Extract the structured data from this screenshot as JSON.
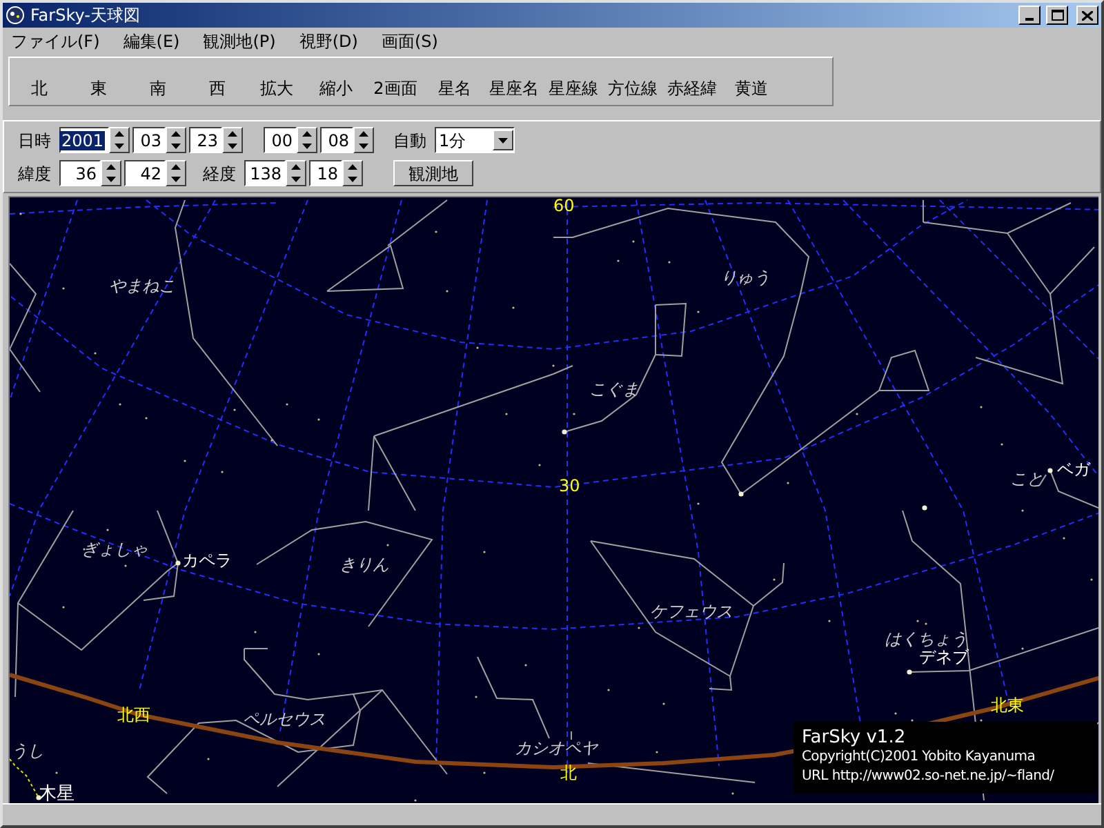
{
  "window": {
    "title": "FarSky-天球図"
  },
  "menu": [
    "ファイル(F)",
    "編集(E)",
    "観測地(P)",
    "視野(D)",
    "画面(S)"
  ],
  "toolbar": [
    "北",
    "東",
    "南",
    "西",
    "拡大",
    "縮小",
    "2画面",
    "星名",
    "星座名",
    "星座線",
    "方位線",
    "赤経緯",
    "黄道"
  ],
  "controls": {
    "datetime_label": "日時",
    "date_fields": [
      {
        "value": "2001",
        "selected": true
      },
      {
        "value": "03",
        "selected": false
      },
      {
        "value": "23",
        "selected": false
      }
    ],
    "time_fields": [
      {
        "value": "00",
        "selected": false
      },
      {
        "value": "08",
        "selected": false
      }
    ],
    "auto_label": "自動",
    "auto_interval": "1分",
    "latitude_label": "緯度",
    "latitude_fields": [
      "36",
      "42"
    ],
    "longitude_label": "経度",
    "longitude_fields": [
      "138",
      "18"
    ],
    "observer_button": "観測地"
  },
  "sky": {
    "labels": [
      {
        "text": "60",
        "kind": "grid"
      },
      {
        "text": "やまねこ",
        "kind": "constellation"
      },
      {
        "text": "りゅう",
        "kind": "constellation"
      },
      {
        "text": "こぐま",
        "kind": "constellation"
      },
      {
        "text": "30",
        "kind": "grid"
      },
      {
        "text": "こと",
        "kind": "constellation"
      },
      {
        "text": "ベガ",
        "kind": "star"
      },
      {
        "text": "ぎょしゃ",
        "kind": "constellation"
      },
      {
        "text": "カペラ",
        "kind": "star"
      },
      {
        "text": "きりん",
        "kind": "constellation"
      },
      {
        "text": "ケフェウス",
        "kind": "constellation"
      },
      {
        "text": "はくちょう",
        "kind": "constellation"
      },
      {
        "text": "デネブ",
        "kind": "star"
      },
      {
        "text": "北西",
        "kind": "direction"
      },
      {
        "text": "ペルセウス",
        "kind": "constellation"
      },
      {
        "text": "北東",
        "kind": "direction"
      },
      {
        "text": "うし",
        "kind": "constellation"
      },
      {
        "text": "カシオペヤ",
        "kind": "constellation"
      },
      {
        "text": "北",
        "kind": "direction"
      },
      {
        "text": "木星",
        "kind": "planet"
      }
    ],
    "credits": [
      "FarSky v1.2",
      "Copyright(C)2001  Yobito Kayanuma",
      "URL http://www02.so-net.ne.jp/~fland/"
    ]
  }
}
